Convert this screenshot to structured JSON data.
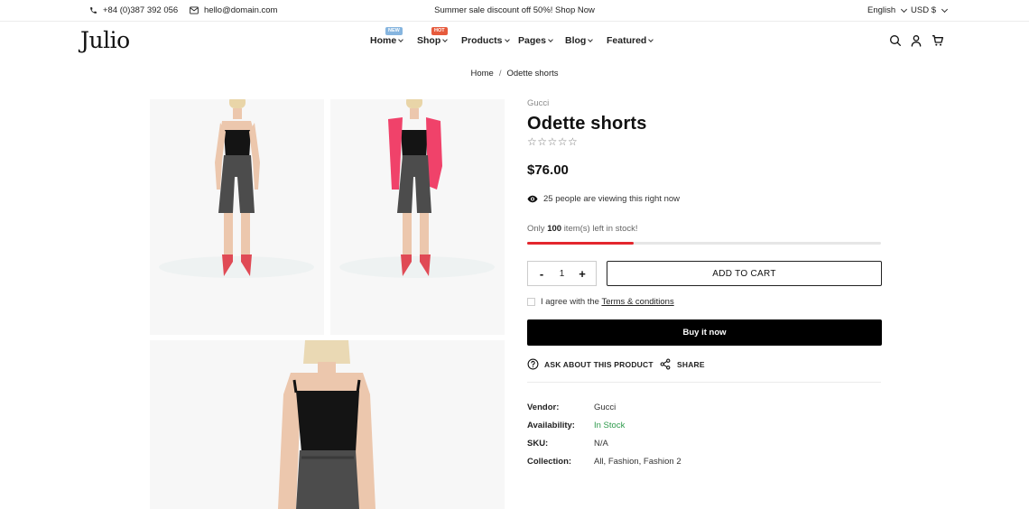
{
  "topbar": {
    "phone": "+84 (0)387 392 056",
    "email": "hello@domain.com",
    "promo": "Summer sale discount off 50%! Shop Now",
    "language": "English",
    "currency": "USD $"
  },
  "header": {
    "logo": "Julio",
    "nav": [
      {
        "label": "Home",
        "badge": "NEW"
      },
      {
        "label": "Shop",
        "badge": "HOT"
      },
      {
        "label": "Products"
      },
      {
        "label": "Pages"
      },
      {
        "label": "Blog"
      },
      {
        "label": "Featured"
      }
    ],
    "icons": [
      "search-icon",
      "account-icon",
      "cart-icon"
    ]
  },
  "breadcrumb": {
    "home": "Home",
    "separator": "/",
    "current": "Odette shorts"
  },
  "product": {
    "vendor": "Gucci",
    "title": "Odette shorts",
    "rating_stars": "☆☆☆☆☆",
    "price": "$76.00",
    "viewing_count": "25",
    "viewing_text": "people are viewing this right now",
    "stock_prefix": "Only",
    "stock_count": "100",
    "stock_suffix": "item(s) left in stock!",
    "stock_level": 0.3,
    "quantity": "1",
    "qty_minus": "-",
    "qty_plus": "+",
    "add_to_cart": "ADD TO CART",
    "agree_text": "I agree with the",
    "terms_link": "Terms & conditions",
    "buy_now": "Buy it now",
    "ask": "ASK ABOUT THIS PRODUCT",
    "share": "SHARE"
  },
  "meta": [
    {
      "key": "Vendor:",
      "value": "Gucci"
    },
    {
      "key": "Availability:",
      "value": "In Stock"
    },
    {
      "key": "SKU:",
      "value": "N/A"
    },
    {
      "key": "Collection:",
      "value": "All, Fashion, Fashion 2"
    }
  ],
  "colors": {
    "stock_bar": "#e3262d",
    "in_stock": "#2d9a4b",
    "badge_new": "#86b5df",
    "badge_hot": "#e65a3c"
  }
}
